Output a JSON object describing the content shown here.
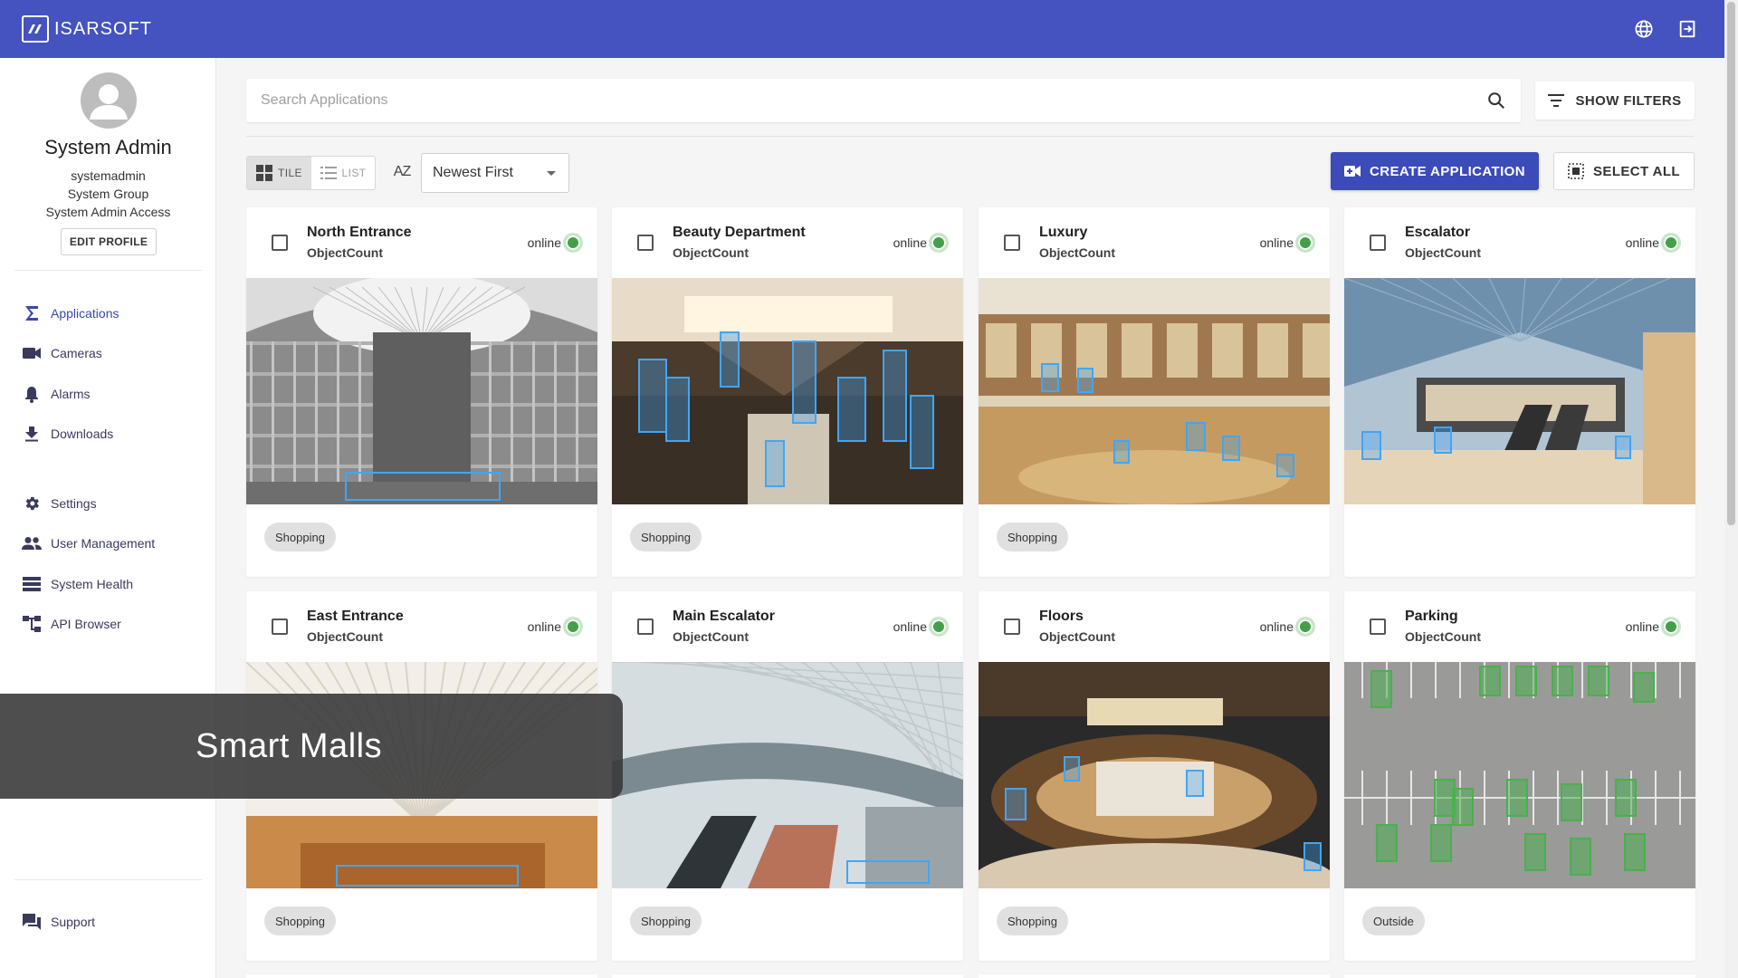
{
  "brand": {
    "logo_text": "ISARSOFT"
  },
  "profile": {
    "name": "System Admin",
    "username": "systemadmin",
    "group": "System Group",
    "access": "System Admin Access",
    "edit_label": "EDIT PROFILE"
  },
  "nav": {
    "applications": "Applications",
    "cameras": "Cameras",
    "alarms": "Alarms",
    "downloads": "Downloads",
    "settings": "Settings",
    "user_management": "User Management",
    "system_health": "System Health",
    "api_browser": "API Browser",
    "support": "Support"
  },
  "search": {
    "placeholder": "Search Applications",
    "value": ""
  },
  "toolbar": {
    "show_filters": "SHOW FILTERS",
    "view_tile": "TILE",
    "view_list": "LIST",
    "az_label": "AZ",
    "sort_selected": "Newest First",
    "create_application": "CREATE APPLICATION",
    "select_all": "SELECT ALL"
  },
  "cards": [
    {
      "title": "North Entrance",
      "type": "ObjectCount",
      "status": "online",
      "tag": "Shopping"
    },
    {
      "title": "Beauty Department",
      "type": "ObjectCount",
      "status": "online",
      "tag": "Shopping"
    },
    {
      "title": "Luxury",
      "type": "ObjectCount",
      "status": "online",
      "tag": "Shopping"
    },
    {
      "title": "Escalator",
      "type": "ObjectCount",
      "status": "online",
      "tag": ""
    },
    {
      "title": "East Entrance",
      "type": "ObjectCount",
      "status": "online",
      "tag": "Shopping"
    },
    {
      "title": "Main Escalator",
      "type": "ObjectCount",
      "status": "online",
      "tag": "Shopping"
    },
    {
      "title": "Floors",
      "type": "ObjectCount",
      "status": "online",
      "tag": "Shopping"
    },
    {
      "title": "Parking",
      "type": "ObjectCount",
      "status": "online",
      "tag": "Outside"
    }
  ],
  "overlay": {
    "caption": "Smart Malls"
  },
  "colors": {
    "topbar": "#4453c0",
    "accent": "#3b4bb8",
    "online": "#43a047",
    "detection_box": "#42a5f5",
    "parking_box": "#4caf50"
  }
}
